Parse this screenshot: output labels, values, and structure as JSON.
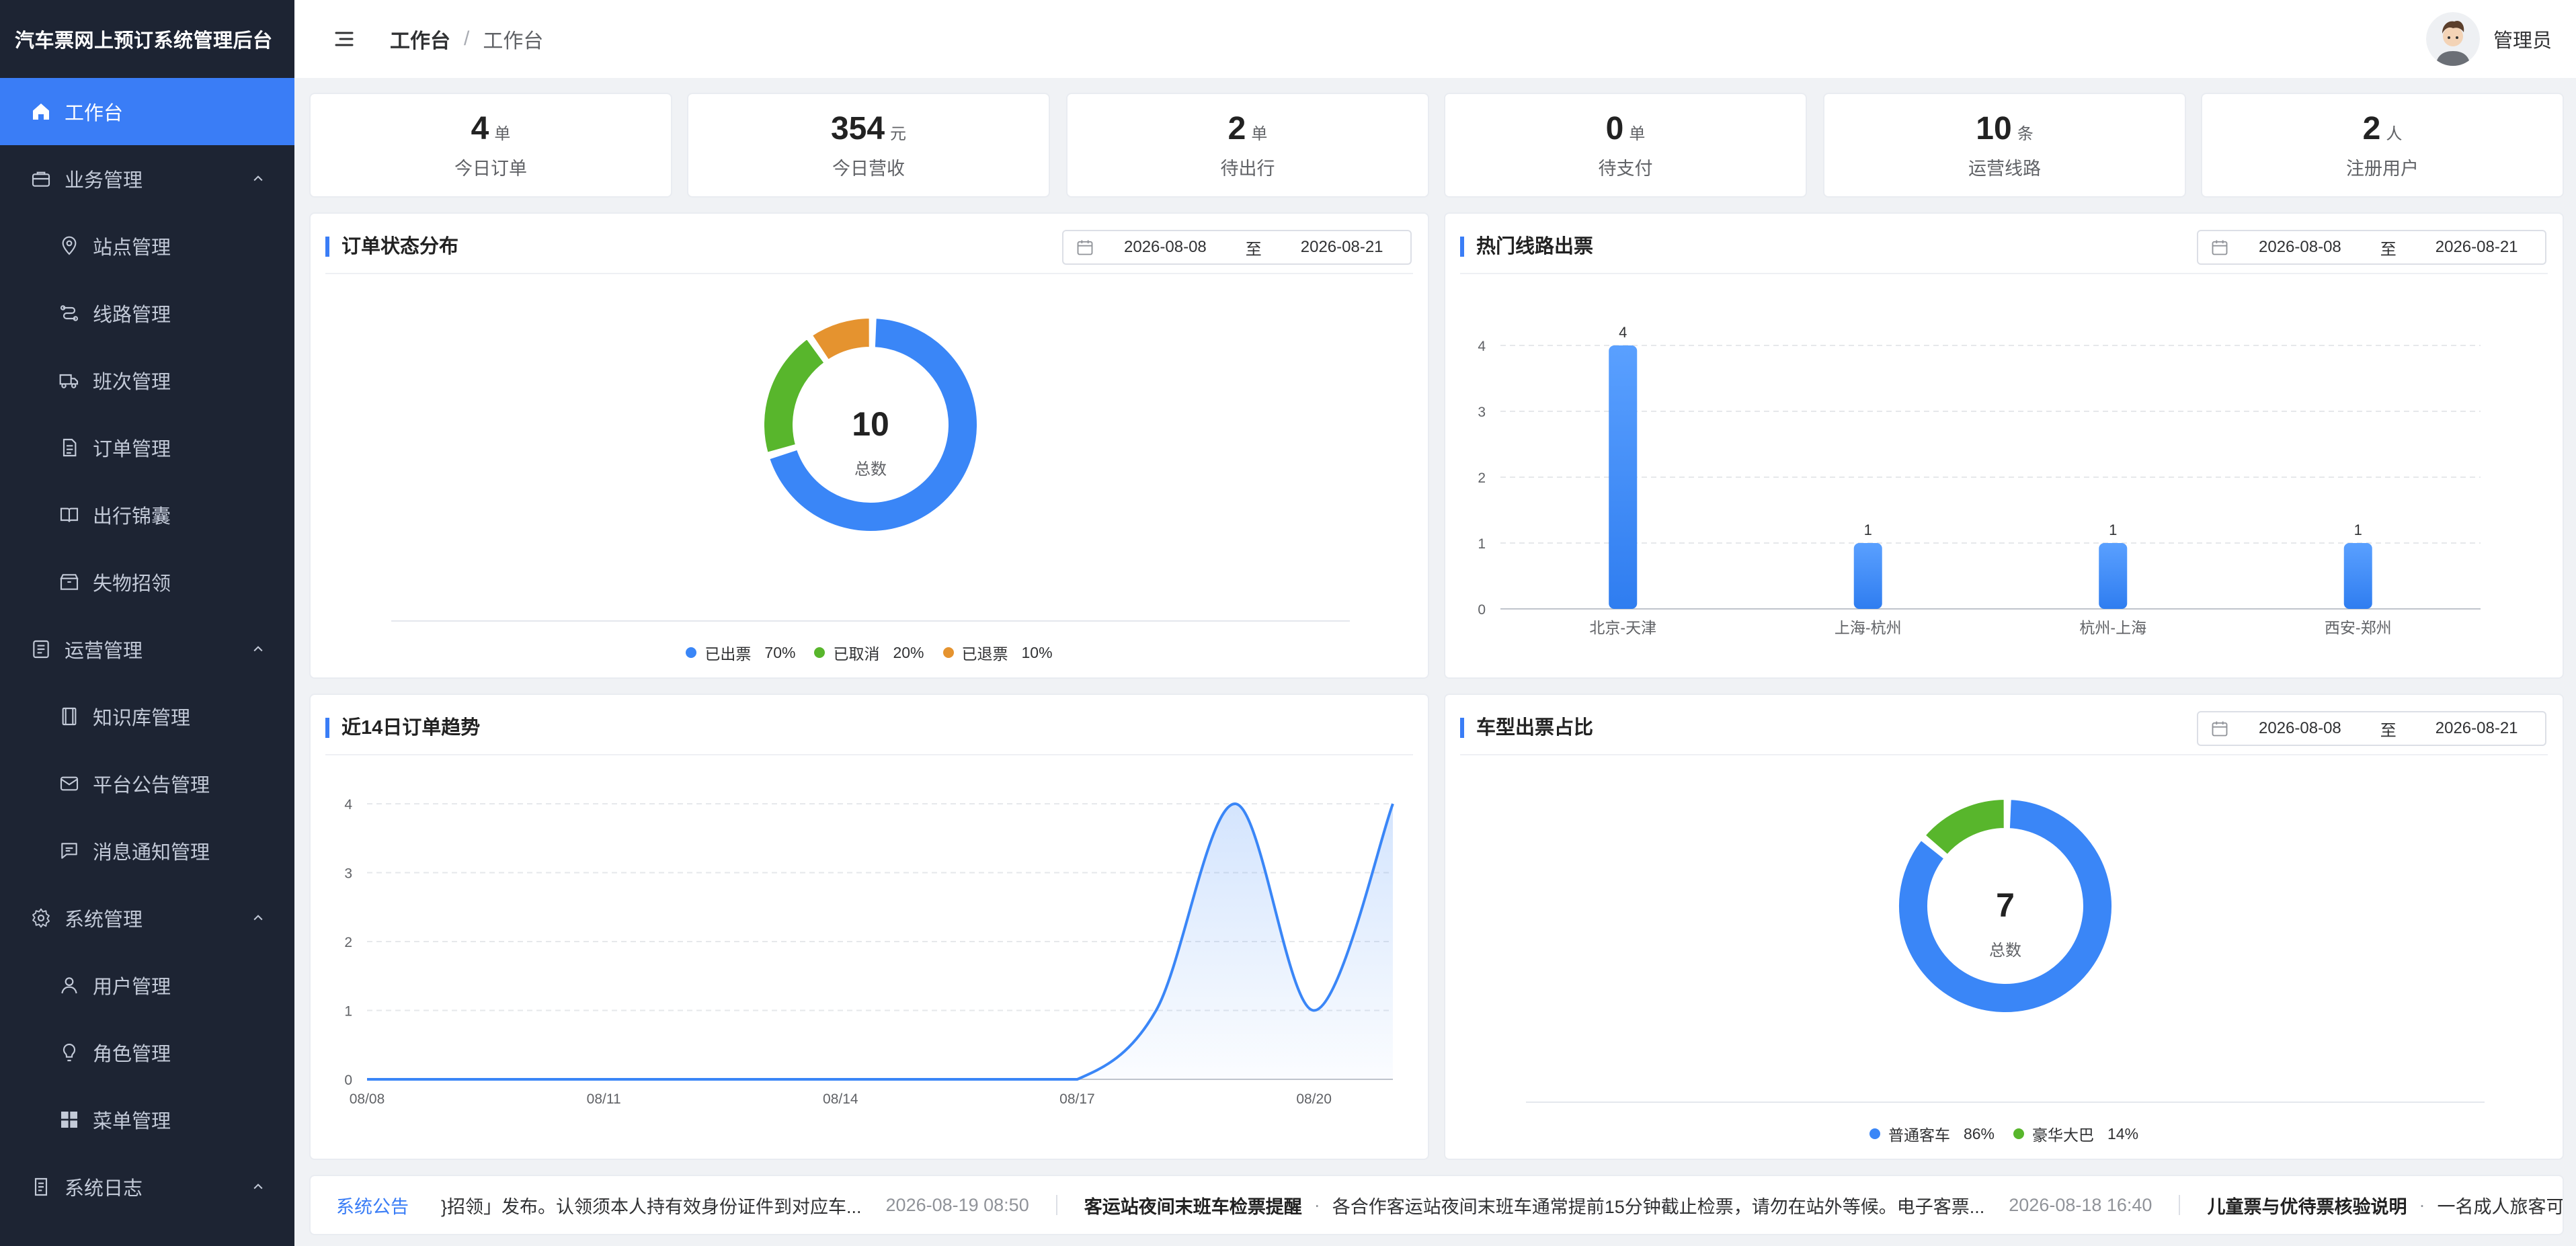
{
  "app_title": "汽车票网上预订系统管理后台",
  "breadcrumb": [
    "工作台",
    "工作台"
  ],
  "user_name": "管理员",
  "menu": [
    {
      "label": "工作台",
      "icon": "home-icon",
      "active": true
    },
    {
      "label": "业务管理",
      "icon": "briefcase-icon",
      "group": true
    },
    {
      "label": "站点管理",
      "icon": "location-icon",
      "sub": true
    },
    {
      "label": "线路管理",
      "icon": "route-icon",
      "sub": true
    },
    {
      "label": "班次管理",
      "icon": "truck-icon",
      "sub": true
    },
    {
      "label": "订单管理",
      "icon": "document-icon",
      "sub": true
    },
    {
      "label": "出行锦囊",
      "icon": "book-icon",
      "sub": true
    },
    {
      "label": "失物招领",
      "icon": "box-icon",
      "sub": true
    },
    {
      "label": "运营管理",
      "icon": "list-icon",
      "group": true
    },
    {
      "label": "知识库管理",
      "icon": "film-icon",
      "sub": true
    },
    {
      "label": "平台公告管理",
      "icon": "mail-icon",
      "sub": true
    },
    {
      "label": "消息通知管理",
      "icon": "message-icon",
      "sub": true
    },
    {
      "label": "系统管理",
      "icon": "gear-icon",
      "group": true
    },
    {
      "label": "用户管理",
      "icon": "user-icon",
      "sub": true
    },
    {
      "label": "角色管理",
      "icon": "bulb-icon",
      "sub": true
    },
    {
      "label": "菜单管理",
      "icon": "grid-icon",
      "sub": true
    },
    {
      "label": "系统日志",
      "icon": "log-icon",
      "group": true
    }
  ],
  "stats": [
    {
      "value": "4",
      "unit": "单",
      "label": "今日订单"
    },
    {
      "value": "354",
      "unit": "元",
      "label": "今日营收"
    },
    {
      "value": "2",
      "unit": "单",
      "label": "待出行"
    },
    {
      "value": "0",
      "unit": "单",
      "label": "待支付"
    },
    {
      "value": "10",
      "unit": "条",
      "label": "运营线路"
    },
    {
      "value": "2",
      "unit": "人",
      "label": "注册用户"
    }
  ],
  "panels": {
    "order_status": {
      "title": "订单状态分布",
      "date_start": "2026-08-08",
      "date_to": "至",
      "date_end": "2026-08-21",
      "center_value": "10",
      "center_label": "总数"
    },
    "hot_routes": {
      "title": "热门线路出票",
      "date_start": "2026-08-08",
      "date_to": "至",
      "date_end": "2026-08-21"
    },
    "trend": {
      "title": "近14日订单趋势"
    },
    "vehicle_type": {
      "title": "车型出票占比",
      "date_start": "2026-08-08",
      "date_to": "至",
      "date_end": "2026-08-21",
      "center_value": "7",
      "center_label": "总数"
    }
  },
  "chart_data": [
    {
      "type": "pie",
      "title": "订单状态分布",
      "total": 10,
      "labels": [
        "已出票",
        "已取消",
        "已退票"
      ],
      "values": [
        7,
        2,
        1
      ],
      "percents": [
        "70%",
        "20%",
        "10%"
      ],
      "colors": [
        "#3a86f7",
        "#58b62c",
        "#e5932f"
      ],
      "legend": "bottom"
    },
    {
      "type": "bar",
      "title": "热门线路出票",
      "categories": [
        "北京-天津",
        "上海-杭州",
        "杭州-上海",
        "西安-郑州"
      ],
      "values": [
        4,
        1,
        1,
        1
      ],
      "ylim": [
        0,
        4
      ],
      "yticks": [
        "0",
        "1",
        "2",
        "3",
        "4"
      ],
      "grid": true,
      "color": "#3a86f7"
    },
    {
      "type": "area",
      "title": "近14日订单趋势",
      "x": [
        "08/08",
        "08/09",
        "08/10",
        "08/11",
        "08/12",
        "08/13",
        "08/14",
        "08/15",
        "08/16",
        "08/17",
        "08/18",
        "08/19",
        "08/20",
        "08/21"
      ],
      "xticks": [
        "08/08",
        "08/11",
        "08/14",
        "08/17",
        "08/20"
      ],
      "values": [
        0,
        0,
        0,
        0,
        0,
        0,
        0,
        0,
        0,
        0,
        1,
        4,
        1,
        4
      ],
      "ylim": [
        0,
        4
      ],
      "yticks": [
        "0",
        "1",
        "2",
        "3",
        "4"
      ],
      "grid": true,
      "color": "#3a86f7"
    },
    {
      "type": "pie",
      "title": "车型出票占比",
      "total": 7,
      "labels": [
        "普通客车",
        "豪华大巴"
      ],
      "values": [
        6,
        1
      ],
      "percents": [
        "86%",
        "14%"
      ],
      "colors": [
        "#3a86f7",
        "#58b62c"
      ],
      "legend": "bottom"
    }
  ],
  "notice": {
    "title": "系统公告",
    "items": [
      {
        "title": "",
        "body": "}招领」发布。认领须本人持有效身份证件到对应车...",
        "time": "2026-08-19 08:50"
      },
      {
        "title": "客运站夜间末班车检票提醒",
        "body": "各合作客运站夜间末班车通常提前15分钟截止检票，请勿在站外等候。电子客票...",
        "time": "2026-08-18 16:40"
      },
      {
        "title": "儿童票与优待票核验说明",
        "body": "一名成人旅客可...",
        "time": ""
      }
    ]
  }
}
